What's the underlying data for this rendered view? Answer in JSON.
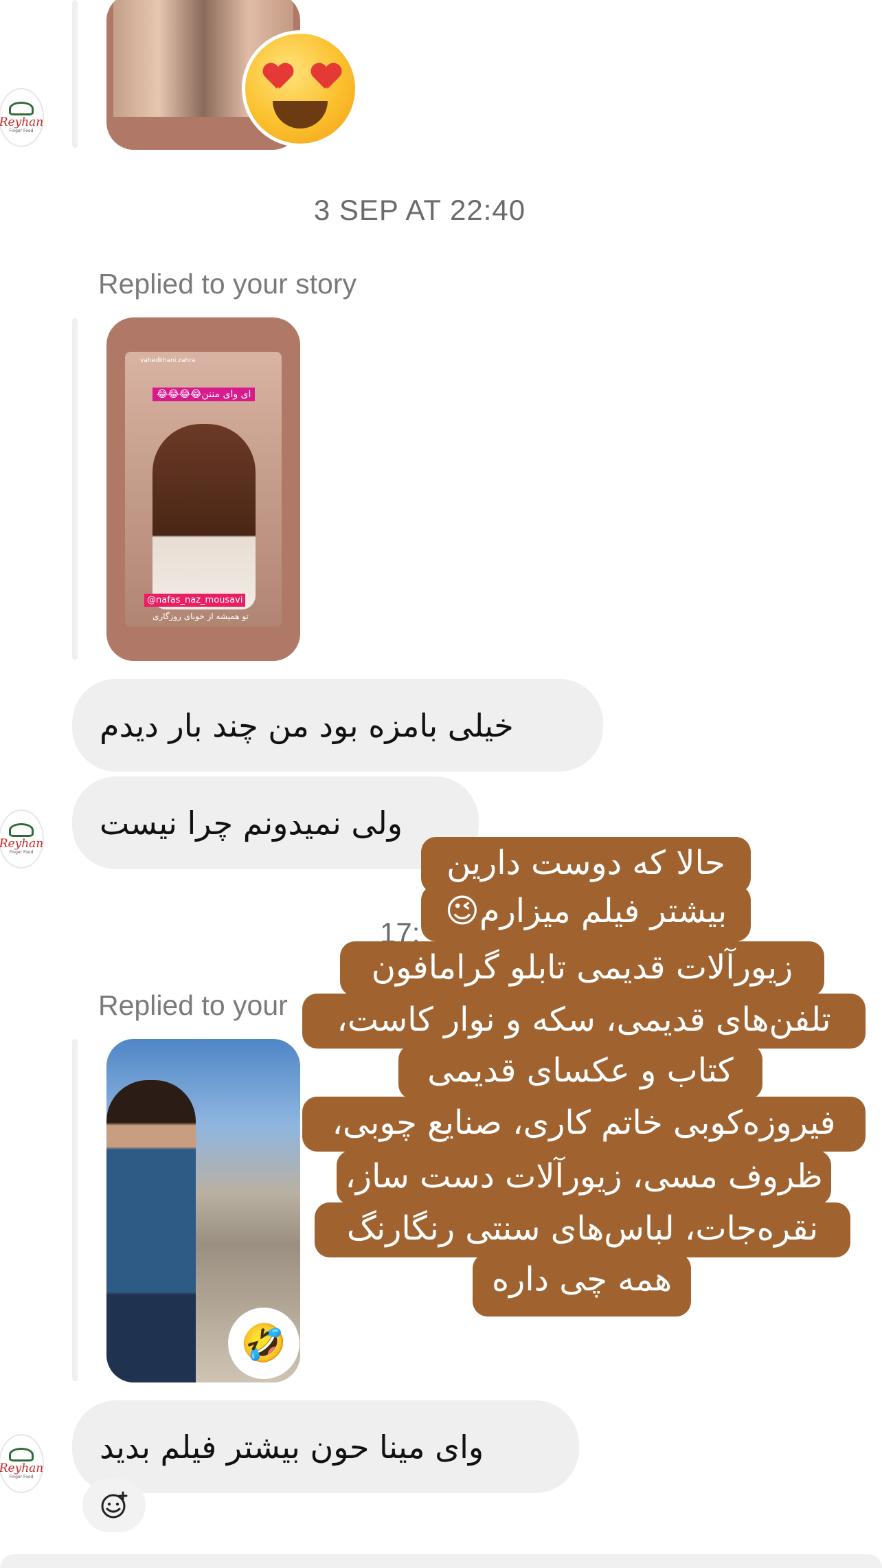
{
  "thread": {
    "timestamp_1": "3 SEP AT 22:40",
    "reply_label_1": "Replied to your story",
    "reply_label_2": "Replied to your",
    "timestamp_2_partial": "17:",
    "avatar_brand": "Reyhan",
    "avatar_sub": "Finger Food"
  },
  "messages": [
    {
      "text": "خیلی بامزه بود من چند بار دیدم"
    },
    {
      "text": "ولی نمیدونم چرا نیست"
    },
    {
      "text": "وای مینا حون بیشتر فیلم بدید"
    }
  ],
  "story_1": {
    "username": "vahedkhani.zahra",
    "caption_top": "ای وای مننن😂😂😂😂",
    "tag": "@nafas_naz_mousavi",
    "caption_bottom": "تو همیشه از خوبای روزگاری"
  },
  "overlay_text": {
    "lines": [
      "حالا که دوست دارین",
      "بیشتر فیلم میزارم😉",
      "زیورآلات قدیمی تابلو گرامافون",
      "تلفن‌های قدیمی، سکه و نوار کاست،",
      "کتاب و عکسای قدیمی",
      "فیروزه‌کوبی خاتم کاری، صنایع چوبی،",
      "ظروف مسی، زیورآلات دست ساز،",
      "نقره‌جات، لباس‌های سنتی رنگارنگ",
      "همه چی داره"
    ]
  },
  "reactions": {
    "story_0": "😍",
    "story_2": "🤣"
  },
  "colors": {
    "bubble": "#efefef",
    "overlay": "#a0622f",
    "story_frame": "#b07866",
    "meta_text": "#6b6b6b"
  }
}
